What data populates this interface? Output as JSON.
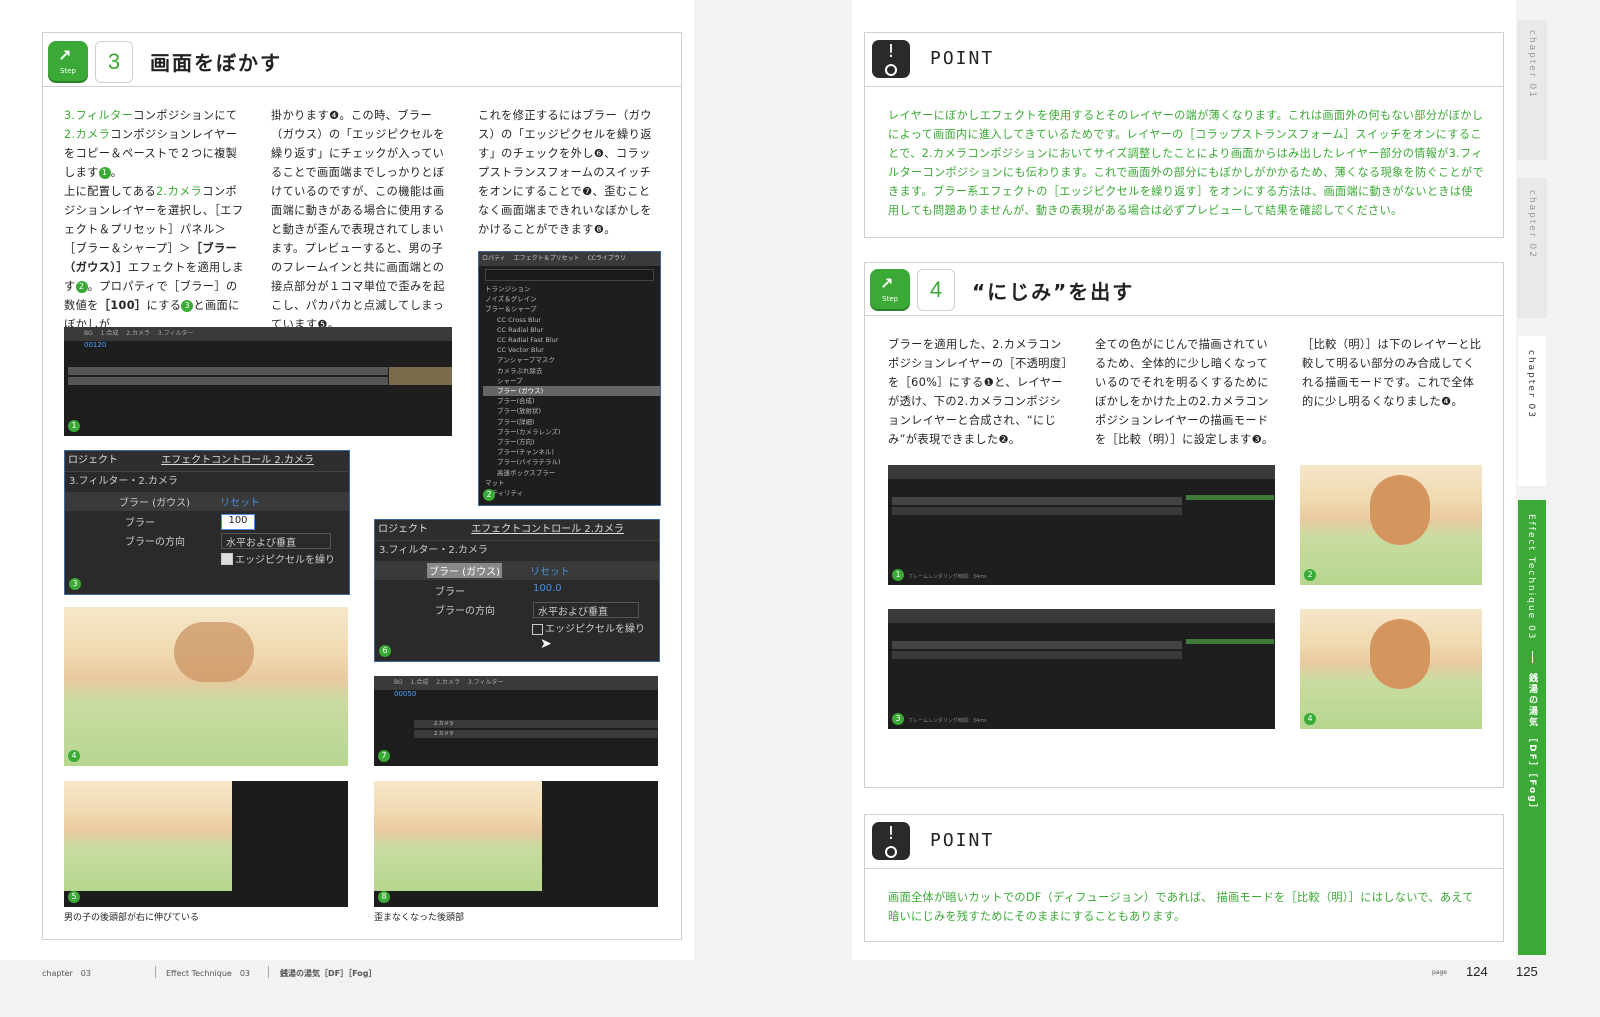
{
  "left": {
    "step_label": "Step",
    "step_number": "3",
    "title": "画面をぼかす",
    "col1": {
      "p1_a": "3.フィルター",
      "p1_b": "コンポジションにて",
      "p1_c": "2.カメラ",
      "p1_d": "コンポジションレイヤーをコピー＆ペーストで２つに複製します",
      "p1_e": "。",
      "p2_a": "上に配置してある",
      "p2_b": "2.カメラ",
      "p2_c": "コンポジションレイヤーを選択し、［エフェクト＆プリセット］パネル＞［ブラー＆シャープ］＞",
      "p2_d": "［ブラー（ガウス）］",
      "p2_e": "エフェクトを適用します",
      "p2_f": "。プロパティで［ブラー］の数値を",
      "p2_g": "［100］",
      "p2_h": "にする",
      "p2_i": "と画面にぼかしが"
    },
    "col2": "掛かります❹。この時、ブラー（ガウス）の「エッジピクセルを繰り返す」にチェックが入っていることで画面端までしっかりとぼけているのですが、この機能は画面端に動きがある場合に使用すると動きが歪んで表現されてしまいます。プレビューすると、男の子のフレームインと共に画面端との接点部分が１コマ単位で歪みを起こし、パカパカと点滅してしまっています❺。",
    "col3": "これを修正するにはブラー（ガウス）の「エッジピクセルを繰り返す」のチェックを外し❻、コラップストランスフォームのスイッチをオンにすることで❼、歪むことなく画面端まできれいなぼかしをかけることができます❽。",
    "nums": [
      "1",
      "2",
      "3",
      "4",
      "5",
      "6",
      "7",
      "8"
    ],
    "ec_panel": {
      "tab1": "ロジェクト",
      "tab2": "エフェクトコントロール 2.カメラ",
      "layer": "3.フィルター・2.カメラ",
      "effect": "ブラー (ガウス)",
      "reset": "リセット",
      "blur_label": "ブラー",
      "blur_value_3": "100",
      "blur_value_6": "100.0",
      "dir_label": "ブラーの方向",
      "dir_value": "水平および垂直",
      "edge_label": "エッジピクセルを繰り"
    },
    "effects_list": {
      "tab1": "ロパティ",
      "tab2": "エフェクト＆プリセット",
      "tab3": "CCライブラリ",
      "items": [
        "トランジション",
        "ノイズ＆グレイン",
        "ブラー＆シャープ",
        "CC Cross Blur",
        "CC Radial Blur",
        "CC Radial Fast Blur",
        "CC Vector Blur",
        "アンシャープマスク",
        "カメラぶれ除去",
        "シャープ",
        "ブラー (ガウス)",
        "ブラー(合成)",
        "ブラー(放射状)",
        "ブラー(詳細)",
        "ブラー(カメラレンズ)",
        "ブラー(方向)",
        "ブラー(チャンネル)",
        "ブラー(バイラテラル)",
        "高速ボックスブラー",
        "マット",
        "ーティリティ"
      ]
    },
    "timeline": {
      "tabs": [
        "BG",
        "1.合成",
        "2.カメラ",
        "3.フィルター"
      ],
      "time_1": "00120",
      "time_7": "00050",
      "layer_name": "2.カメラ"
    },
    "caption5": "男の子の後頭部が右に伸びている",
    "caption8": "歪まなくなった後頭部"
  },
  "right": {
    "point_label": "POINT",
    "point1": "レイヤーにぼかしエフェクトを使用するとそのレイヤーの端が薄くなります。これは画面外の何もない部分がぼかしによって画面内に進入してきているためです。レイヤーの［コラップストランスフォーム］スイッチをオンにすることで、2.カメラコンポジションにおいてサイズ調整したことにより画面からはみ出したレイヤー部分の情報が3.フィルターコンポジションにも伝わります。これで画面外の部分にもぼかしがかかるため、薄くなる現象を防ぐことができます。ブラー系エフェクトの［エッジピクセルを繰り返す］をオンにする方法は、画面端に動きがないときは使用しても問題ありませんが、動きの表現がある場合は必ずプレビューして結果を確認してください。",
    "step_label": "Step",
    "step_number": "4",
    "title": "“にじみ”を出す",
    "col1": "ブラーを適用した、2.カメラコンポジションレイヤーの［不透明度］を［60%］にする❶と、レイヤーが透け、下の2.カメラコンポジションレイヤーと合成され、“にじみ”が表現できました❷。",
    "col2": "全ての色がにじんで描画されているため、全体的に少し暗くなっているのでそれを明るくするためにぼかしをかけた上の2.カメラコンポジションレイヤーの描画モードを［比較（明）］に設定します❸。",
    "col3": "［比較（明）］は下のレイヤーと比較して明るい部分のみ合成してくれる描画モードです。これで全体的に少し明るくなりました❹。",
    "point2": "画面全体が暗いカットでのDF（ディフュージョン）であれば、 描画モードを［比較（明）］にはしないで、あえて暗いにじみを残すためにそのままにすることもあります。",
    "timeline_status": "フレームレンダリング時間：34ms",
    "nums": [
      "1",
      "2",
      "3",
      "4"
    ]
  },
  "side_tabs": {
    "t1": "chapter 01",
    "t2": "chapter 02",
    "t3": "chapter 03",
    "t4": "Effect Technique 03",
    "t5": "銭湯の湯気 ［DF］［Fog］"
  },
  "footer": {
    "chapter": "chapter　03",
    "technique": "Effect Technique　03",
    "topic": "銭湯の湯気［DF］［Fog］",
    "page_label": "page",
    "page_left": "124",
    "page_right": "125"
  }
}
